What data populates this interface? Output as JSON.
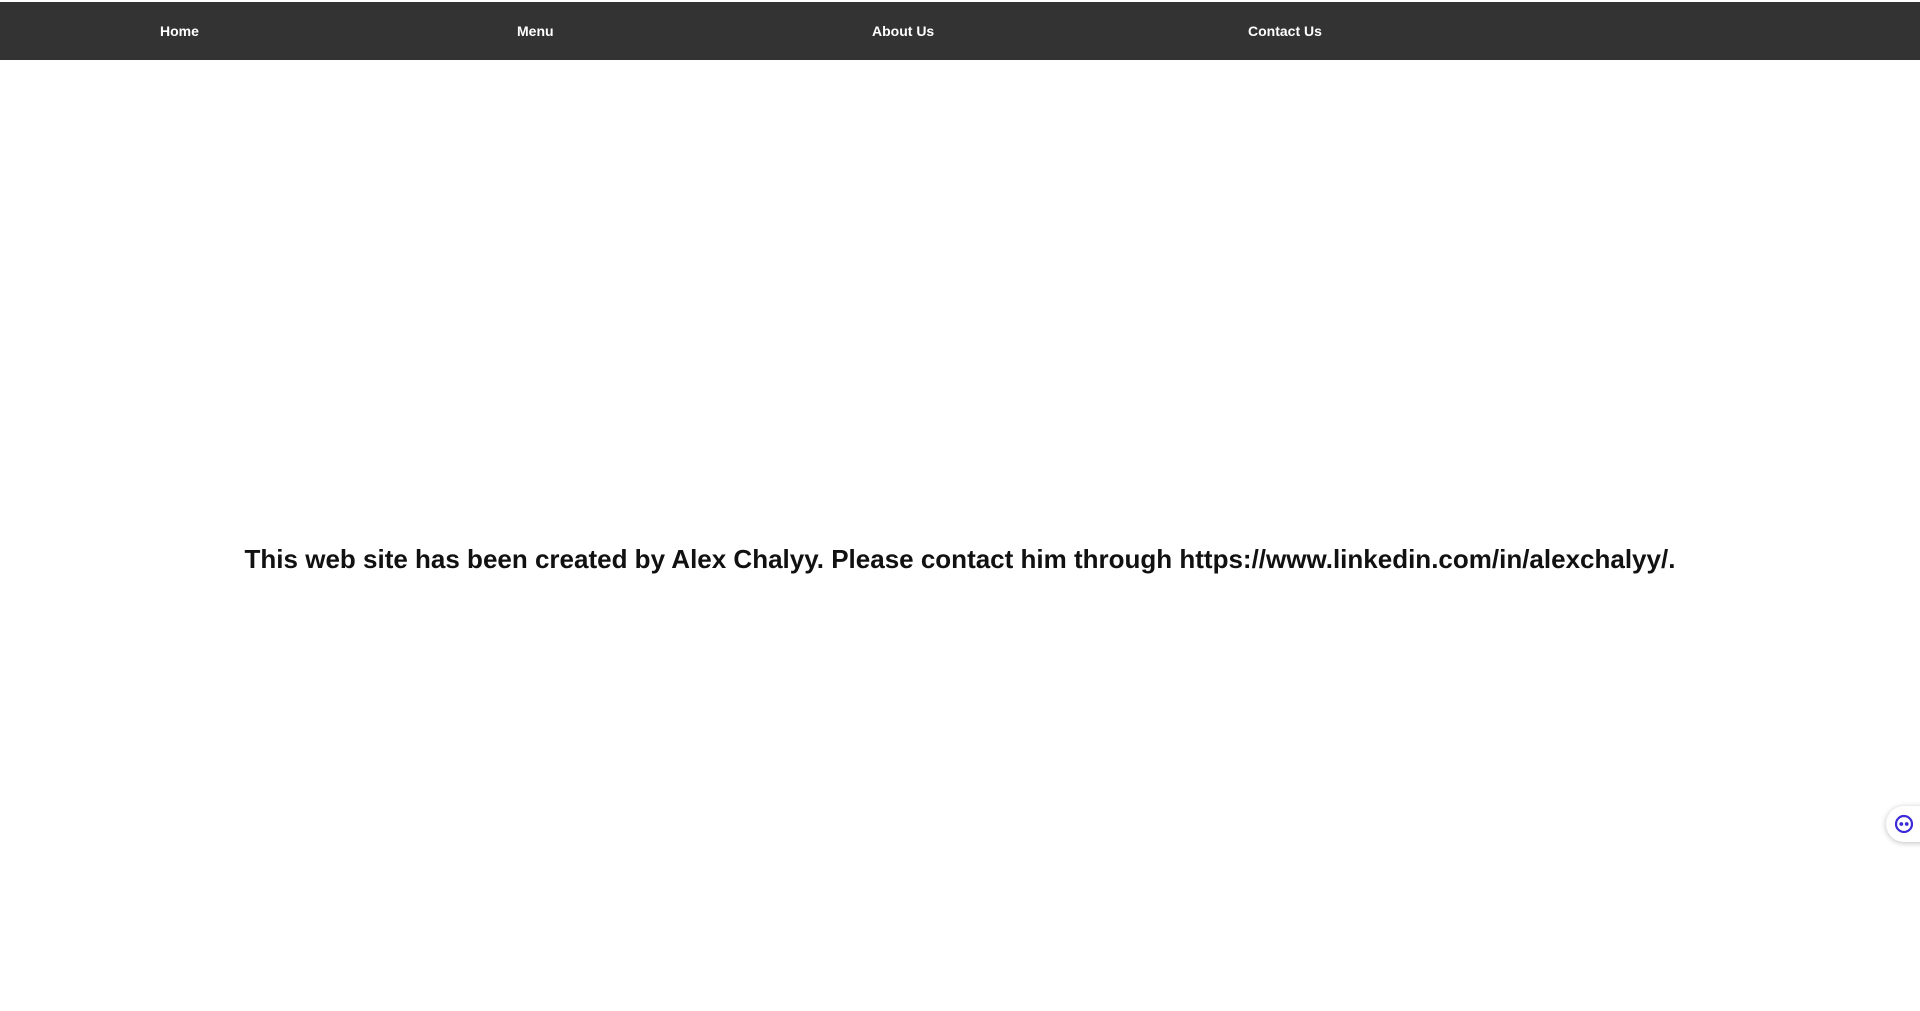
{
  "nav": {
    "items": [
      {
        "label": "Home"
      },
      {
        "label": "Menu"
      },
      {
        "label": "About Us"
      },
      {
        "label": "Contact Us"
      }
    ],
    "background": "#333333",
    "text_color": "#ffffff"
  },
  "main": {
    "message": "This web site has been created by Alex Chalyy. Please contact him through https://www.linkedin.com/in/alexchalyy/."
  },
  "widget": {
    "icon": "chat-face-icon",
    "accent": "#3b2bd6"
  }
}
